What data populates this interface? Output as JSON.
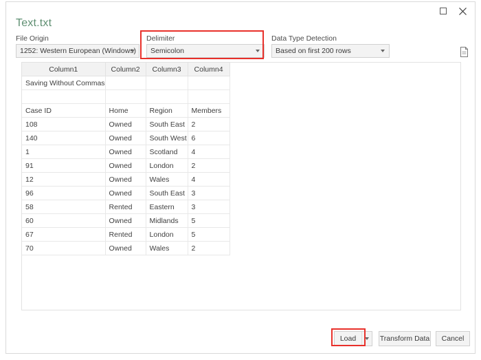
{
  "window": {
    "controls": {
      "maximize": "maximize-icon",
      "close": "close-icon"
    },
    "file_title": "Text.txt"
  },
  "options": {
    "file_origin": {
      "label": "File Origin",
      "value": "1252: Western European (Windows)"
    },
    "delimiter": {
      "label": "Delimiter",
      "value": "Semicolon"
    },
    "data_type_detection": {
      "label": "Data Type Detection",
      "value": "Based on first 200 rows"
    },
    "doc_icon": "document-settings-icon"
  },
  "preview": {
    "headers": [
      "Column1",
      "Column2",
      "Column3",
      "Column4"
    ],
    "rows": [
      [
        "Saving Without Commas",
        "",
        "",
        ""
      ],
      [
        "",
        "",
        "",
        ""
      ],
      [
        "Case ID",
        "Home",
        "Region",
        "Members"
      ],
      [
        "108",
        "Owned",
        "South East",
        "2"
      ],
      [
        "140",
        "Owned",
        "South West",
        "6"
      ],
      [
        "1",
        "Owned",
        "Scotland",
        "4"
      ],
      [
        "91",
        "Owned",
        "London",
        "2"
      ],
      [
        "12",
        "Owned",
        "Wales",
        "4"
      ],
      [
        "96",
        "Owned",
        "South East",
        "3"
      ],
      [
        "58",
        "Rented",
        "Eastern",
        "3"
      ],
      [
        "60",
        "Owned",
        "Midlands",
        "5"
      ],
      [
        "67",
        "Rented",
        "London",
        "5"
      ],
      [
        "70",
        "Owned",
        "Wales",
        "2"
      ]
    ]
  },
  "footer": {
    "load_label": "Load",
    "load_dropdown": "chevron-down-icon",
    "transform_label": "Transform Data",
    "cancel_label": "Cancel"
  },
  "annotations": {
    "highlight_color": "#e8302a"
  }
}
